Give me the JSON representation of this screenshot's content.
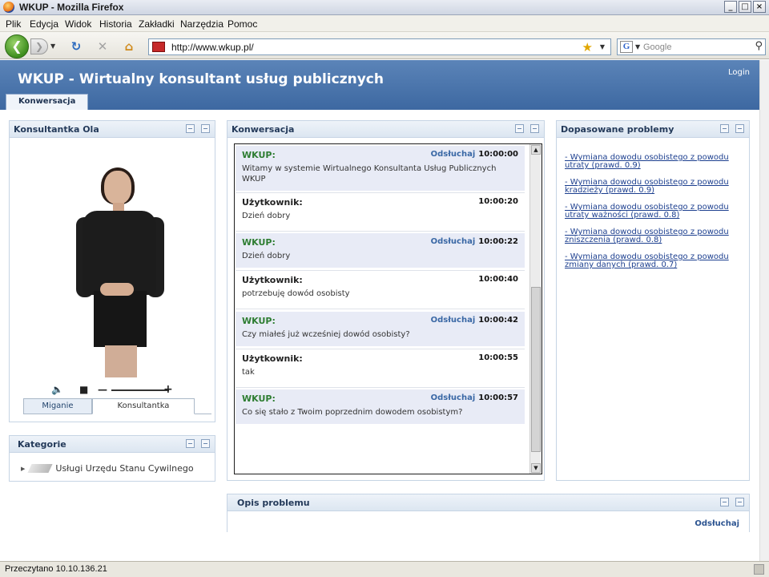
{
  "browser": {
    "window_title": "WKUP - Mozilla Firefox",
    "window_buttons": [
      "_",
      "□",
      "×"
    ],
    "menu": [
      "Plik",
      "Edycja",
      "Widok",
      "Historia",
      "Zakładki",
      "Narzędzia",
      "Pomoc"
    ],
    "url": "http://www.wkup.pl/",
    "search_placeholder": "Google",
    "status": "Przeczytano 10.10.136.21"
  },
  "app": {
    "title": "WKUP - Wirtualny konsultant usług publicznych",
    "login": "Login",
    "main_tab": "Konwersacja"
  },
  "consultant_panel": {
    "title": "Konsultantka Ola",
    "tabs": [
      "Miganie",
      "Konsultantka"
    ]
  },
  "categories_panel": {
    "title": "Kategorie",
    "items": [
      "Usługi Urzędu Stanu Cywilnego"
    ]
  },
  "conversation_panel": {
    "title": "Konwersacja",
    "listen_label": "Odsłuchaj",
    "messages": [
      {
        "sender": "WKUP:",
        "time": "10:00:00",
        "text": "Witamy w systemie Wirtualnego Konsultanta Usług Publicznych WKUP"
      },
      {
        "sender": "Użytkownik:",
        "time": "10:00:20",
        "text": "Dzień dobry"
      },
      {
        "sender": "WKUP:",
        "time": "10:00:22",
        "text": "Dzień dobry"
      },
      {
        "sender": "Użytkownik:",
        "time": "10:00:40",
        "text": "potrzebuję dowód osobisty"
      },
      {
        "sender": "WKUP:",
        "time": "10:00:42",
        "text": "Czy miałeś już wcześniej dowód osobisty?"
      },
      {
        "sender": "Użytkownik:",
        "time": "10:00:55",
        "text": "tak"
      },
      {
        "sender": "WKUP:",
        "time": "10:00:57",
        "text": "Co się stało z Twoim poprzednim dowodem osobistym?"
      }
    ]
  },
  "problems_panel": {
    "title": "Dopasowane problemy",
    "items": [
      "- Wymiana dowodu osobistego z powodu utraty (prawd. 0.9)",
      "- Wymiana dowodu osobistego z powodu kradzieży  (prawd. 0.9)",
      "- Wymiana dowodu osobistego z powodu utraty ważności (prawd. 0.8)",
      "- Wymiana dowodu osobistego z powodu zniszczenia (prawd. 0.8)",
      "- Wymiana dowodu osobistego z powodu zmiany danych (prawd. 0.7)"
    ]
  },
  "description_panel": {
    "title": "Opis problemu",
    "listen": "Odsłuchaj"
  },
  "icons": {
    "panel_tools": [
      "minimize-icon",
      "maximize-icon"
    ],
    "media": [
      "speaker-icon",
      "stop-icon",
      "volume-minus-icon",
      "volume-plus-icon"
    ]
  }
}
